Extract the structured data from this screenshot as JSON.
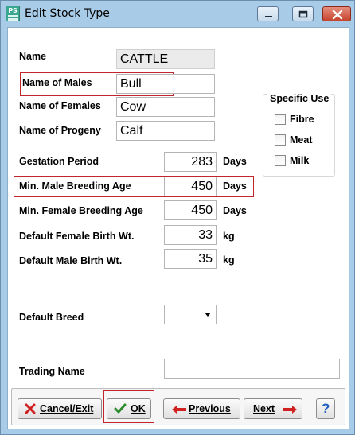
{
  "window": {
    "title": "Edit Stock Type",
    "icon_text": "PS"
  },
  "fields": {
    "name": {
      "label": "Name",
      "value": "CATTLE"
    },
    "males": {
      "label": "Name of Males",
      "value": "Bull"
    },
    "females": {
      "label": "Name of Females",
      "value": "Cow"
    },
    "progeny": {
      "label": "Name of Progeny",
      "value": "Calf"
    },
    "gestation": {
      "label": "Gestation Period",
      "value": "283",
      "unit": "Days"
    },
    "min_male_age": {
      "label": "Min. Male Breeding Age",
      "value": "450",
      "unit": "Days"
    },
    "min_female_age": {
      "label": "Min. Female Breeding Age",
      "value": "450",
      "unit": "Days"
    },
    "female_birth_wt": {
      "label": "Default Female Birth Wt.",
      "value": "33",
      "unit": "kg"
    },
    "male_birth_wt": {
      "label": "Default Male Birth Wt.",
      "value": "35",
      "unit": "kg"
    },
    "default_breed": {
      "label": "Default Breed",
      "value": ""
    },
    "trading_name": {
      "label": "Trading Name",
      "value": ""
    }
  },
  "specific_use": {
    "title": "Specific Use",
    "options": [
      {
        "label": "Fibre",
        "checked": false
      },
      {
        "label": "Meat",
        "checked": false
      },
      {
        "label": "Milk",
        "checked": false
      }
    ]
  },
  "buttons": {
    "cancel": "Cancel/Exit",
    "ok": "OK",
    "previous": "Previous",
    "next": "Next",
    "help": "?"
  },
  "colors": {
    "highlight": "#c0262c",
    "title_bar": "#a8cce8",
    "red_arrow": "#d02020",
    "check_green": "#2e8b2e",
    "help_blue": "#1f5fbf"
  }
}
